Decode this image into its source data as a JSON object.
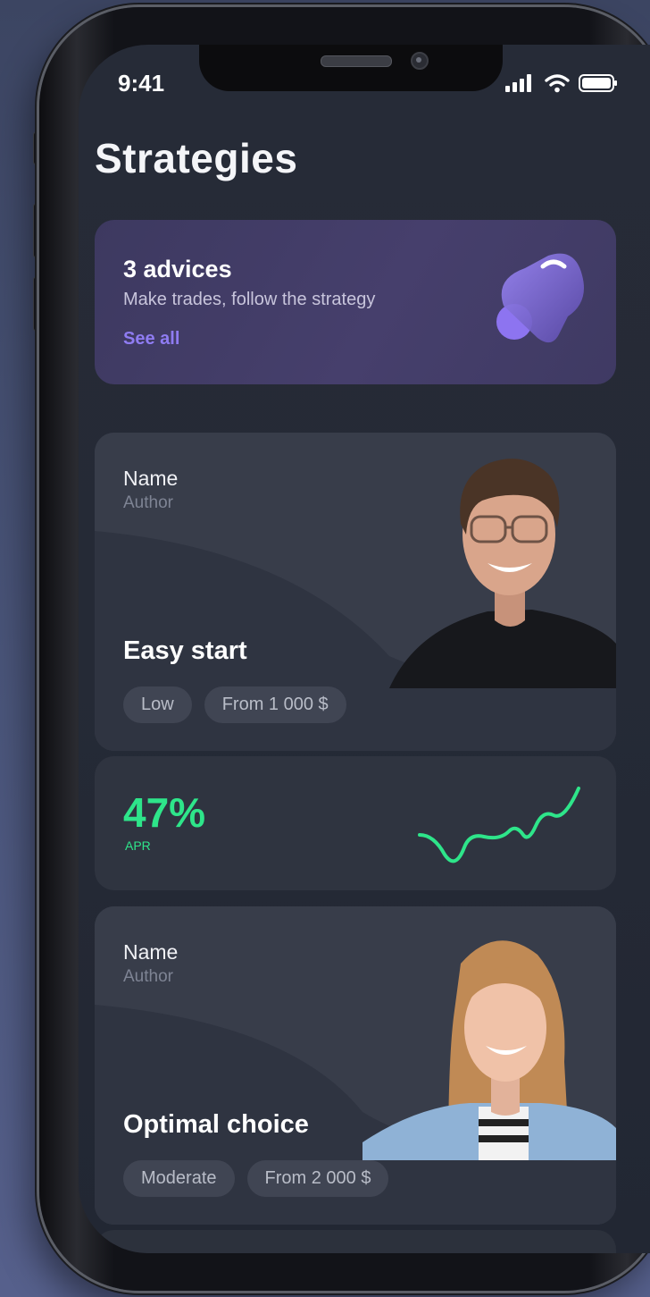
{
  "status_bar": {
    "time": "9:41",
    "icons": [
      "signal-icon",
      "wifi-icon",
      "battery-icon"
    ]
  },
  "page": {
    "title": "Strategies"
  },
  "advice_card": {
    "heading": "3 advices",
    "subtitle": "Make trades, follow the strategy",
    "link": "See all",
    "icon": "bell-icon"
  },
  "strategies": [
    {
      "name": "Name",
      "author": "Author",
      "title": "Easy start",
      "risk": "Low",
      "min_amount": "From 1 000 $",
      "apr": {
        "value": "47%",
        "label": "APR"
      }
    },
    {
      "name": "Name",
      "author": "Author",
      "title": "Optimal choice",
      "risk": "Moderate",
      "min_amount": "From 2 000 $"
    }
  ],
  "colors": {
    "background": "#252a36",
    "card": "#353a46",
    "advice_card": "#433d68",
    "accent_purple": "#8f7cf2",
    "apr_green": "#2ee58a"
  }
}
